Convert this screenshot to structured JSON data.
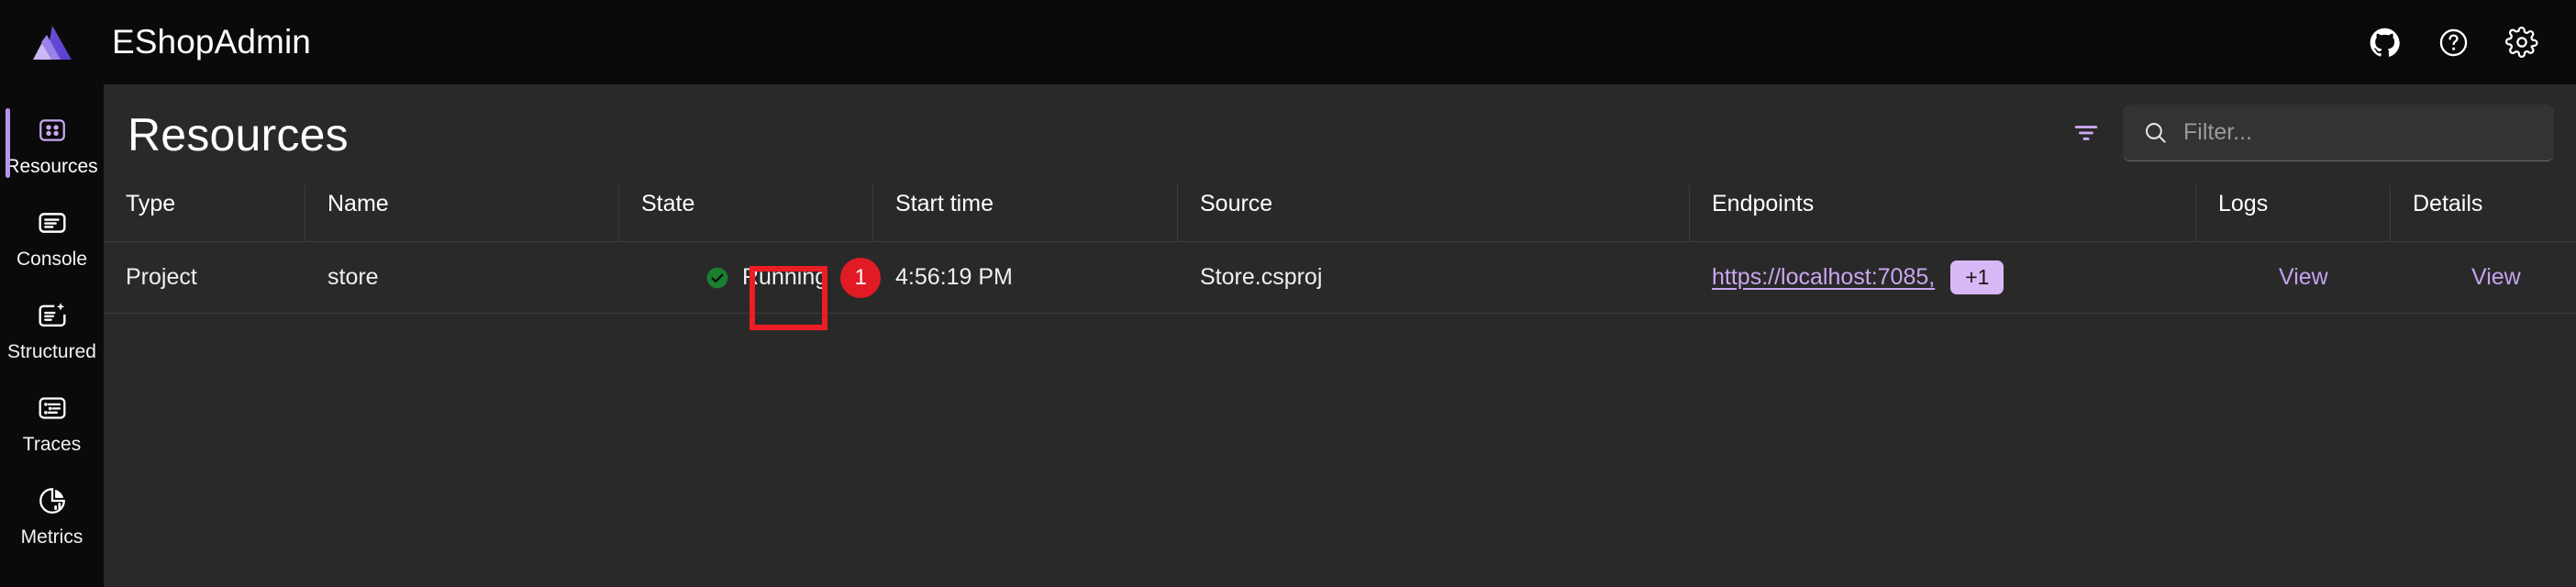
{
  "header": {
    "app_title": "EShopAdmin",
    "logo_icon": "aspire-logo-icon",
    "actions": [
      {
        "name": "github-icon",
        "label": "GitHub"
      },
      {
        "name": "help-icon",
        "label": "Help"
      },
      {
        "name": "gear-icon",
        "label": "Settings"
      }
    ]
  },
  "sidebar": {
    "items": [
      {
        "label": "Resources",
        "icon": "grid-icon",
        "active": true
      },
      {
        "label": "Console",
        "icon": "console-logs-icon",
        "active": false
      },
      {
        "label": "Structured",
        "icon": "structured-logs-icon",
        "active": false
      },
      {
        "label": "Traces",
        "icon": "traces-icon",
        "active": false
      },
      {
        "label": "Metrics",
        "icon": "metrics-pie-icon",
        "active": false
      }
    ]
  },
  "main": {
    "page_title": "Resources",
    "filter_icon": "filter-funnel-icon",
    "search": {
      "icon": "search-icon",
      "placeholder": "Filter...",
      "value": ""
    },
    "table": {
      "columns": [
        "Type",
        "Name",
        "State",
        "Start time",
        "Source",
        "Endpoints",
        "Logs",
        "Details"
      ],
      "rows": [
        {
          "type": "Project",
          "name": "store",
          "state": {
            "icon": "status-running-check-icon",
            "text": "Running",
            "badge_count": "1"
          },
          "start_time": "4:56:19 PM",
          "source": "Store.csproj",
          "endpoints": {
            "link": "https://localhost:7085,",
            "more_badge": "+1"
          },
          "logs": "View",
          "details": "View"
        }
      ]
    }
  },
  "annotation": {
    "box_color": "#ee1c25",
    "target": "state-badge-highlight"
  },
  "colors": {
    "accent_purple": "#b794e8",
    "link_purple": "#c3a3ef",
    "status_green": "#1a7f2e",
    "badge_red": "#e01b24",
    "annotation_red": "#ee1c25",
    "header_bg": "#0a0a0a",
    "main_bg": "#292929"
  }
}
